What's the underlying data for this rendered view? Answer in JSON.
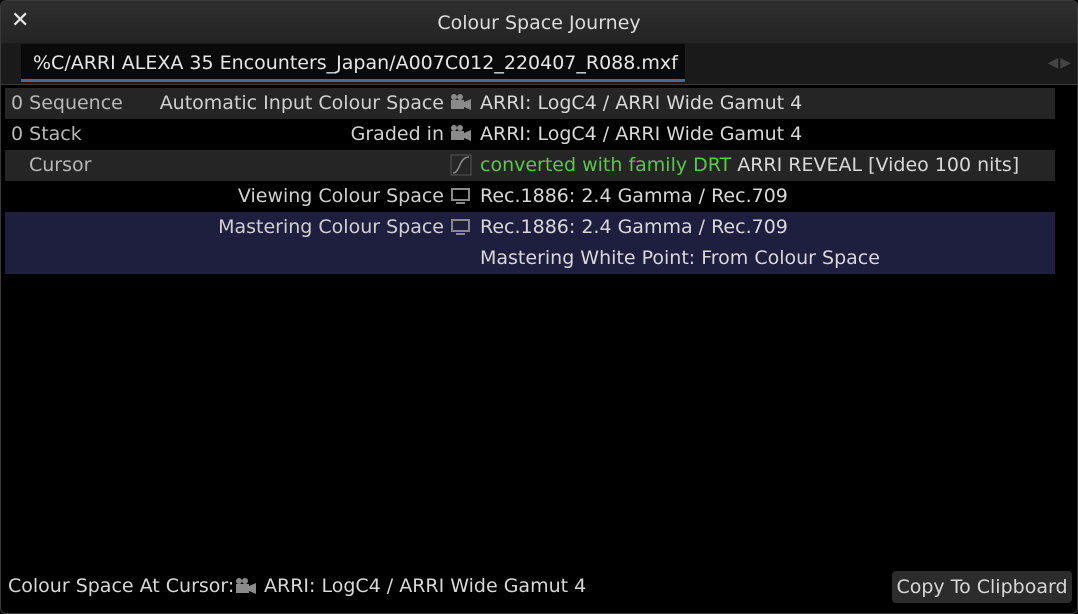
{
  "window": {
    "title": "Colour Space Journey",
    "close_icon": "close-icon"
  },
  "tabs": [
    {
      "label": "%C/ARRI ALEXA 35 Encounters_Japan/A007C012_220407_R088.mxf"
    }
  ],
  "rows": [
    {
      "left": "0 Sequence",
      "mid": "Automatic Input Colour Space",
      "icon": "camera-icon",
      "value": "ARRI: LogC4 / ARRI Wide Gamut 4"
    },
    {
      "left": "0 Stack",
      "mid": "Graded in",
      "icon": "camera-icon",
      "value": "ARRI: LogC4 / ARRI Wide Gamut 4"
    },
    {
      "left": "Cursor",
      "mid": "",
      "icon": "curve-icon",
      "value_highlight": "converted with family DRT",
      "value": "ARRI REVEAL [Video 100 nits]"
    },
    {
      "left": "",
      "mid": "Viewing Colour Space",
      "icon": "monitor-icon",
      "value": "Rec.1886: 2.4 Gamma / Rec.709"
    },
    {
      "left": "",
      "mid": "Mastering Colour Space",
      "icon": "monitor-icon",
      "value": "Rec.1886: 2.4 Gamma / Rec.709"
    },
    {
      "left": "",
      "mid": "",
      "icon": "",
      "value": "Mastering White Point: From Colour Space"
    }
  ],
  "footer": {
    "label": "Colour Space At Cursor:",
    "icon": "camera-icon",
    "value": "ARRI: LogC4 / ARRI Wide Gamut 4",
    "copy_label": "Copy To Clipboard"
  },
  "colors": {
    "accent": "#3b6ea8",
    "highlight_text": "#59c84b",
    "selected_row": "#1e1f3f"
  }
}
